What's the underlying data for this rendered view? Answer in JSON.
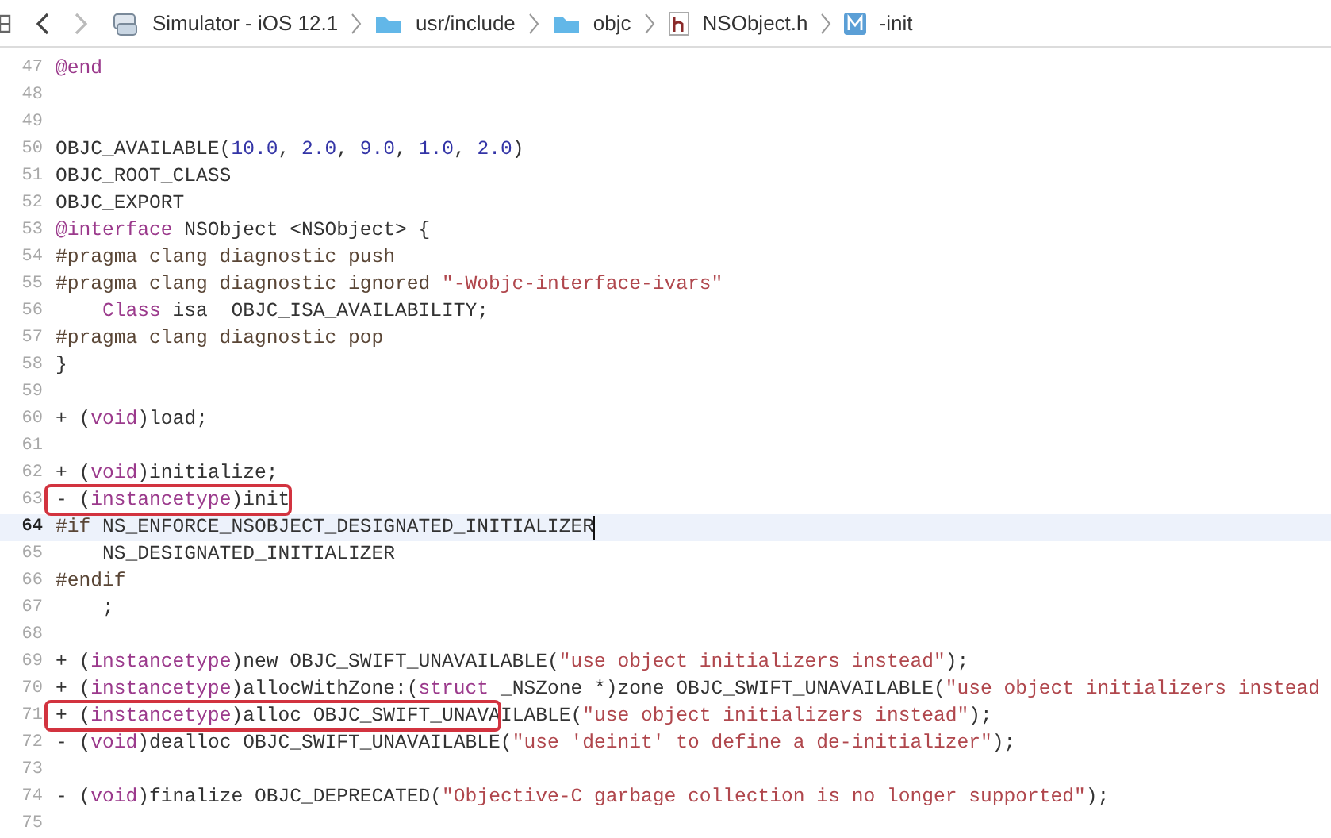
{
  "jump_bar": {
    "back": {
      "disabled": false
    },
    "forward": {
      "disabled": true
    },
    "path": [
      {
        "kind": "simulator",
        "label": "Simulator - iOS 12.1"
      },
      {
        "kind": "folder",
        "label": "usr/include"
      },
      {
        "kind": "folder",
        "label": "objc"
      },
      {
        "kind": "header",
        "label": "NSObject.h"
      },
      {
        "kind": "method",
        "label": "-init"
      }
    ]
  },
  "lines": [
    {
      "number": "47",
      "current": false,
      "tokens": [
        {
          "kind": "kw",
          "text": "@end"
        }
      ]
    },
    {
      "number": "48",
      "current": false
    },
    {
      "number": "49",
      "current": false
    },
    {
      "number": "50",
      "current": false,
      "tokens": [
        {
          "kind": "plain",
          "text": "OBJC_AVAILABLE("
        },
        {
          "kind": "num",
          "text": "10.0"
        },
        {
          "kind": "plain",
          "text": ", "
        },
        {
          "kind": "num",
          "text": "2.0"
        },
        {
          "kind": "plain",
          "text": ", "
        },
        {
          "kind": "num",
          "text": "9.0"
        },
        {
          "kind": "plain",
          "text": ", "
        },
        {
          "kind": "num",
          "text": "1.0"
        },
        {
          "kind": "plain",
          "text": ", "
        },
        {
          "kind": "num",
          "text": "2.0"
        },
        {
          "kind": "plain",
          "text": ")"
        }
      ]
    },
    {
      "number": "51",
      "current": false,
      "tokens": [
        {
          "kind": "plain",
          "text": "OBJC_ROOT_CLASS"
        }
      ]
    },
    {
      "number": "52",
      "current": false,
      "tokens": [
        {
          "kind": "plain",
          "text": "OBJC_EXPORT"
        }
      ]
    },
    {
      "number": "53",
      "current": false,
      "tokens": [
        {
          "kind": "kw",
          "text": "@interface"
        },
        {
          "kind": "plain",
          "text": " NSObject <NSObject> {"
        }
      ]
    },
    {
      "number": "54",
      "current": false,
      "tokens": [
        {
          "kind": "pp",
          "text": "#pragma clang diagnostic push"
        }
      ]
    },
    {
      "number": "55",
      "current": false,
      "tokens": [
        {
          "kind": "pp",
          "text": "#pragma clang diagnostic ignored "
        },
        {
          "kind": "str",
          "text": "\"-Wobjc-interface-ivars\""
        }
      ]
    },
    {
      "number": "56",
      "current": false,
      "tokens": [
        {
          "kind": "kw",
          "text": "    Class"
        },
        {
          "kind": "plain",
          "text": " isa  OBJC_ISA_AVAILABILITY;"
        }
      ]
    },
    {
      "number": "57",
      "current": false,
      "tokens": [
        {
          "kind": "pp",
          "text": "#pragma clang diagnostic pop"
        }
      ]
    },
    {
      "number": "58",
      "current": false,
      "tokens": [
        {
          "kind": "plain",
          "text": "}"
        }
      ]
    },
    {
      "number": "59",
      "current": false
    },
    {
      "number": "60",
      "current": false,
      "tokens": [
        {
          "kind": "plain",
          "text": "+ ("
        },
        {
          "kind": "kw",
          "text": "void"
        },
        {
          "kind": "plain",
          "text": ")load;"
        }
      ]
    },
    {
      "number": "61",
      "current": false
    },
    {
      "number": "62",
      "current": false,
      "tokens": [
        {
          "kind": "plain",
          "text": "+ ("
        },
        {
          "kind": "kw",
          "text": "void"
        },
        {
          "kind": "plain",
          "text": ")initialize;"
        }
      ]
    },
    {
      "number": "63",
      "current": false,
      "tokens": [
        {
          "kind": "plain",
          "text": "- (",
          "boxed": true
        },
        {
          "kind": "kw",
          "text": "instancetype",
          "boxed": true
        },
        {
          "kind": "plain",
          "text": ")init",
          "boxed": true
        }
      ]
    },
    {
      "number": "64",
      "current": true,
      "tokens": [
        {
          "kind": "pp",
          "text": "#if"
        },
        {
          "kind": "plain",
          "text": " NS_ENFORCE_NSOBJECT_DESIGNATED_INITIALIZER"
        }
      ]
    },
    {
      "number": "65",
      "current": false,
      "tokens": [
        {
          "kind": "plain",
          "text": "    NS_DESIGNATED_INITIALIZER"
        }
      ]
    },
    {
      "number": "66",
      "current": false,
      "tokens": [
        {
          "kind": "pp",
          "text": "#endif"
        }
      ]
    },
    {
      "number": "67",
      "current": false,
      "tokens": [
        {
          "kind": "plain",
          "text": "    ;"
        }
      ]
    },
    {
      "number": "68",
      "current": false
    },
    {
      "number": "69",
      "current": false,
      "tokens": [
        {
          "kind": "plain",
          "text": "+ ("
        },
        {
          "kind": "kw",
          "text": "instancetype"
        },
        {
          "kind": "plain",
          "text": ")new OBJC_SWIFT_UNAVAILABLE("
        },
        {
          "kind": "str",
          "text": "\"use object initializers instead\""
        },
        {
          "kind": "plain",
          "text": ");"
        }
      ]
    },
    {
      "number": "70",
      "current": false,
      "tokens": [
        {
          "kind": "plain",
          "text": "+ ("
        },
        {
          "kind": "kw",
          "text": "instancetype"
        },
        {
          "kind": "plain",
          "text": ")allocWithZone:("
        },
        {
          "kind": "kw",
          "text": "struct"
        },
        {
          "kind": "plain",
          "text": " _NSZone *)zone OBJC_SWIFT_UNAVAILABLE("
        },
        {
          "kind": "str",
          "text": "\"use object initializers instead"
        }
      ]
    },
    {
      "number": "71",
      "current": false,
      "tokens": [
        {
          "kind": "plain",
          "text": "+ (",
          "boxed": true
        },
        {
          "kind": "kw",
          "text": "instancetype",
          "boxed": true
        },
        {
          "kind": "plain",
          "text": ")alloc OBJC_SWIFT_UNAVA",
          "boxed": true
        },
        {
          "kind": "plain",
          "text": "ILABLE("
        },
        {
          "kind": "str",
          "text": "\"use object initializers instead\""
        },
        {
          "kind": "plain",
          "text": ");"
        }
      ]
    },
    {
      "number": "72",
      "current": false,
      "tokens": [
        {
          "kind": "plain",
          "text": "- ("
        },
        {
          "kind": "kw",
          "text": "void"
        },
        {
          "kind": "plain",
          "text": ")dealloc OBJC_SWIFT_UNAVAILABLE("
        },
        {
          "kind": "str",
          "text": "\"use 'deinit' to define a de-initializer\""
        },
        {
          "kind": "plain",
          "text": ");"
        }
      ]
    },
    {
      "number": "73",
      "current": false
    },
    {
      "number": "74",
      "current": false,
      "tokens": [
        {
          "kind": "plain",
          "text": "- ("
        },
        {
          "kind": "kw",
          "text": "void"
        },
        {
          "kind": "plain",
          "text": ")finalize OBJC_DEPRECATED("
        },
        {
          "kind": "str",
          "text": "\"Objective-C garbage collection is no longer supported\""
        },
        {
          "kind": "plain",
          "text": ");"
        }
      ]
    },
    {
      "number": "75",
      "current": false
    }
  ]
}
